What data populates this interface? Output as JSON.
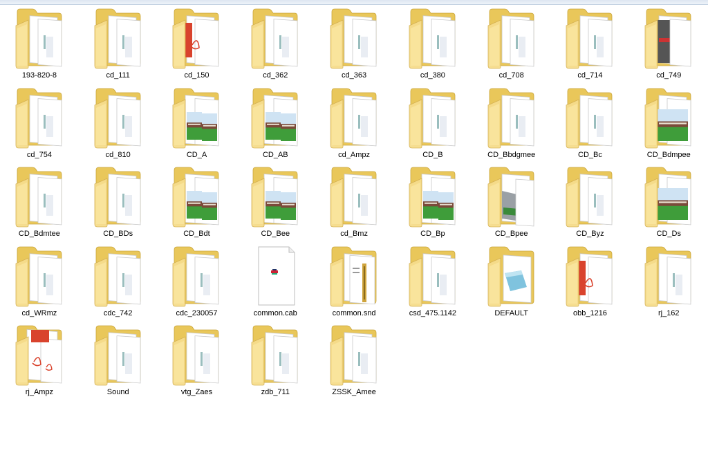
{
  "window": {
    "view_mode": "large-icons"
  },
  "files": [
    {
      "name": "193-820-8",
      "kind": "folder-docs"
    },
    {
      "name": "cd_111",
      "kind": "folder-docs"
    },
    {
      "name": "cd_150",
      "kind": "folder-pdf"
    },
    {
      "name": "cd_362",
      "kind": "folder-docs"
    },
    {
      "name": "cd_363",
      "kind": "folder-docs"
    },
    {
      "name": "cd_380",
      "kind": "folder-docs"
    },
    {
      "name": "cd_708",
      "kind": "folder-docs"
    },
    {
      "name": "cd_714",
      "kind": "folder-docs"
    },
    {
      "name": "cd_749",
      "kind": "folder-photo-dark"
    },
    {
      "name": "cd_754",
      "kind": "folder-docs"
    },
    {
      "name": "cd_810",
      "kind": "folder-docs"
    },
    {
      "name": "CD_A",
      "kind": "folder-photo-train"
    },
    {
      "name": "CD_AB",
      "kind": "folder-photo-train"
    },
    {
      "name": "cd_Ampz",
      "kind": "folder-docs"
    },
    {
      "name": "CD_B",
      "kind": "folder-docs"
    },
    {
      "name": "CD_Bbdgmee",
      "kind": "folder-docs"
    },
    {
      "name": "CD_Bc",
      "kind": "folder-docs"
    },
    {
      "name": "CD_Bdmpee",
      "kind": "folder-photo-single"
    },
    {
      "name": "CD_Bdmtee",
      "kind": "folder-docs"
    },
    {
      "name": "CD_BDs",
      "kind": "folder-docs"
    },
    {
      "name": "CD_Bdt",
      "kind": "folder-photo-train"
    },
    {
      "name": "CD_Bee",
      "kind": "folder-photo-train"
    },
    {
      "name": "cd_Bmz",
      "kind": "folder-docs"
    },
    {
      "name": "CD_Bp",
      "kind": "folder-photo-train"
    },
    {
      "name": "CD_Bpee",
      "kind": "folder-photo-grey"
    },
    {
      "name": "CD_Byz",
      "kind": "folder-docs"
    },
    {
      "name": "CD_Ds",
      "kind": "folder-photo-single"
    },
    {
      "name": "cd_WRmz",
      "kind": "folder-docs"
    },
    {
      "name": "cdc_742",
      "kind": "folder-docs"
    },
    {
      "name": "cdc_230057",
      "kind": "folder-docs"
    },
    {
      "name": "common.cab",
      "kind": "file-cab"
    },
    {
      "name": "common.snd",
      "kind": "folder-zip"
    },
    {
      "name": "csd_475.1142",
      "kind": "folder-docs"
    },
    {
      "name": "DEFAULT",
      "kind": "folder-app"
    },
    {
      "name": "obb_1216",
      "kind": "folder-pdf"
    },
    {
      "name": "rj_162",
      "kind": "folder-docs"
    },
    {
      "name": "rj_Ampz",
      "kind": "folder-pdf-open"
    },
    {
      "name": "Sound",
      "kind": "folder-docs"
    },
    {
      "name": "vtg_Zaes",
      "kind": "folder-docs"
    },
    {
      "name": "zdb_711",
      "kind": "folder-docs"
    },
    {
      "name": "ZSSK_Amee",
      "kind": "folder-docs"
    }
  ],
  "colors": {
    "folder_back": "#e9c75a",
    "folder_front": "#f6dd8c",
    "page": "#ffffff",
    "page_edge": "#c9c9c9",
    "selection": "#cce8ff"
  }
}
